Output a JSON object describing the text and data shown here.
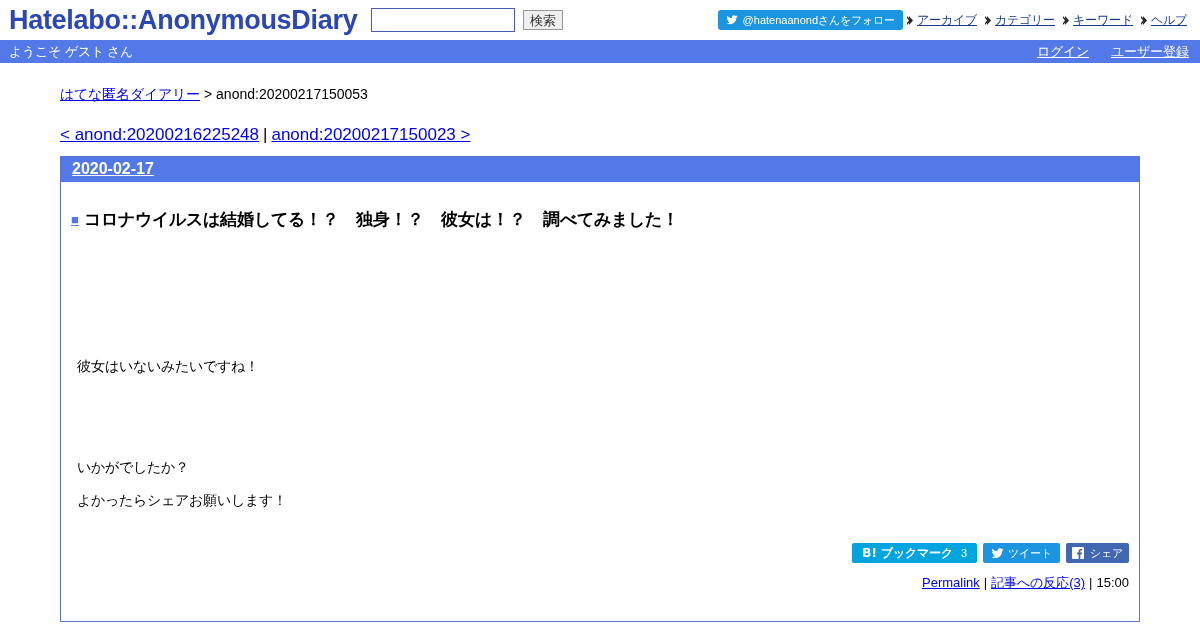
{
  "header": {
    "logo": "Hatelabo::AnonymousDiary",
    "search": {
      "button": "検索"
    },
    "follow_button": "@hatenaanondさんをフォロー",
    "nav_links": [
      "アーカイブ",
      "カテゴリー",
      "キーワード",
      "ヘルプ"
    ]
  },
  "user_bar": {
    "welcome": "ようこそ ゲスト さん",
    "links": [
      "ログイン",
      "ユーザー登録"
    ]
  },
  "breadcrumb": {
    "link": "はてな匿名ダイアリー",
    "current": "> anond:20200217150053"
  },
  "pager": {
    "prev": "< anond:20200216225248",
    "separator": "|",
    "next": "anond:20200217150023 >"
  },
  "entry": {
    "date": "2020-02-17",
    "square": "■",
    "title": "コロナウイルスは結婚してる！？　独身！？　彼女は！？　調べてみました！",
    "paragraphs": [
      "彼女はいないみたいですね！",
      "いかがでしたか？",
      "よかったらシェアお願いします！"
    ],
    "share_buttons": [
      {
        "kind": "bookmark",
        "logo": "B!",
        "label": "ブックマーク",
        "count": "3"
      },
      {
        "kind": "tweet",
        "label": "ツイート"
      },
      {
        "kind": "facebook",
        "label": "シェア"
      }
    ],
    "footer": {
      "permalink": "Permalink",
      "sep1": "|",
      "reactions": "記事への反応(3)",
      "sep2": "|",
      "time": "15:00"
    }
  }
}
